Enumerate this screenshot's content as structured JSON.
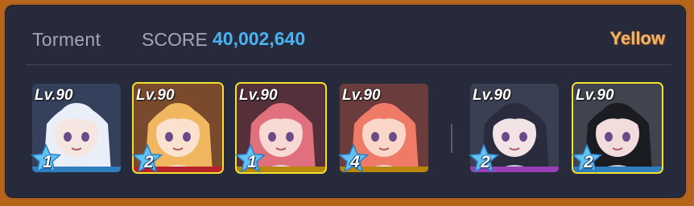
{
  "header": {
    "difficulty": "Torment",
    "score_label": "SCORE",
    "score_value": "40,002,640",
    "armor_type": "Yellow"
  },
  "colors": {
    "score": "#49b2f2",
    "armor": "#f0b36a",
    "selected_frame": "#f2e12f"
  },
  "team": [
    {
      "level": "Lv.90",
      "star": "1",
      "selected": false,
      "role_color": "#2f7fc0",
      "hair": "#e9eef8",
      "skin": "#f6e6e2",
      "bg": "#34405c"
    },
    {
      "level": "Lv.90",
      "star": "2",
      "selected": true,
      "role_color": "#b8202a",
      "hair": "#f0b660",
      "skin": "#fbe2cf",
      "bg": "#7a4a2c"
    },
    {
      "level": "Lv.90",
      "star": "1",
      "selected": true,
      "role_color": "#b8860b",
      "hair": "#e0707d",
      "skin": "#f7d8d2",
      "bg": "#55303a"
    },
    {
      "level": "Lv.90",
      "star": "4",
      "selected": false,
      "role_color": "#b8860b",
      "hair": "#ef7b66",
      "skin": "#fad7c9",
      "bg": "#6a3c3c"
    },
    {
      "level": "Lv.90",
      "star": "2",
      "selected": false,
      "role_color": "#9a3fb8",
      "hair": "#2a2c3e",
      "skin": "#f2e4e4",
      "bg": "#3b3f52"
    },
    {
      "level": "Lv.90",
      "star": "2",
      "selected": true,
      "role_color": "#2f7fc0",
      "hair": "#1b1b22",
      "skin": "#f2dcdc",
      "bg": "#40444f"
    }
  ]
}
